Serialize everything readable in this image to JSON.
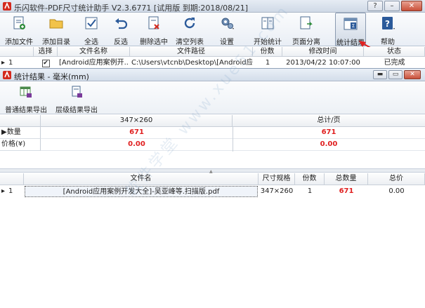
{
  "app": {
    "title": "乐闪软件-PDF尺寸统计助手 V2.3.6771 [试用版 到期:2018/08/21]"
  },
  "window_buttons": {
    "help": "?",
    "minimize": "–",
    "close": "✕"
  },
  "toolbar": [
    {
      "id": "add-file",
      "label": "添加文件",
      "icon": "add-file-icon"
    },
    {
      "id": "add-dir",
      "label": "添加目录",
      "icon": "folder-icon"
    },
    {
      "id": "select-all",
      "label": "全选",
      "icon": "checkbox-icon"
    },
    {
      "id": "invert",
      "label": "反选",
      "icon": "undo-icon"
    },
    {
      "id": "delete-selected",
      "label": "删除选中",
      "icon": "delete-file-icon"
    },
    {
      "id": "clear-list",
      "label": "清空列表",
      "icon": "refresh-icon"
    },
    {
      "id": "settings",
      "label": "设置",
      "icon": "gear-icon"
    },
    {
      "id": "start-stats",
      "label": "开始统计",
      "icon": "document-icon"
    },
    {
      "id": "split-pages",
      "label": "页面分离",
      "icon": "split-icon"
    },
    {
      "id": "stats-result",
      "label": "统计结果",
      "icon": "sum-icon"
    },
    {
      "id": "help",
      "label": "帮助",
      "icon": "help-icon"
    }
  ],
  "file_table": {
    "headers": [
      "选择",
      "文件名称",
      "文件路径",
      "份数",
      "修改时间",
      "状态"
    ],
    "rows": [
      {
        "index": "1",
        "checked": "✔",
        "name": "[Android应用案例开...",
        "path": "C:\\Users\\vtcnb\\Desktop\\[Android应...",
        "copies": "1",
        "modified": "2013/04/22 10:07:00",
        "status": "已完成"
      }
    ]
  },
  "child_window": {
    "title": "统计结果 - 毫米(mm)",
    "toolbar": [
      {
        "id": "export-normal",
        "label": "普通结果导出",
        "icon": "excel-export-icon"
      },
      {
        "id": "export-layer",
        "label": "层级结果导出",
        "icon": "layer-export-icon"
      }
    ],
    "summary": {
      "columns": [
        "347×260",
        "总计/页"
      ],
      "rows": [
        {
          "label": "数量",
          "values": [
            "671",
            "671"
          ],
          "marker": "▶"
        },
        {
          "label": "价格(¥)",
          "values": [
            "0.00",
            "0.00"
          ],
          "marker": ""
        }
      ]
    },
    "detail": {
      "headers": [
        "文件名",
        "尺寸规格",
        "份数",
        "总数量",
        "总价"
      ],
      "rows": [
        {
          "index": "1",
          "name": "[Android应用案例开发大全]-吴亚峰等.扫描版.pdf",
          "size": "347×260",
          "copies": "1",
          "total_qty": "671",
          "total_price": "0.00"
        }
      ]
    }
  },
  "watermark": "软件学堂 www.xue51.com",
  "colors": {
    "accent_red": "#e02020",
    "title_bar": "#d3ddea"
  }
}
